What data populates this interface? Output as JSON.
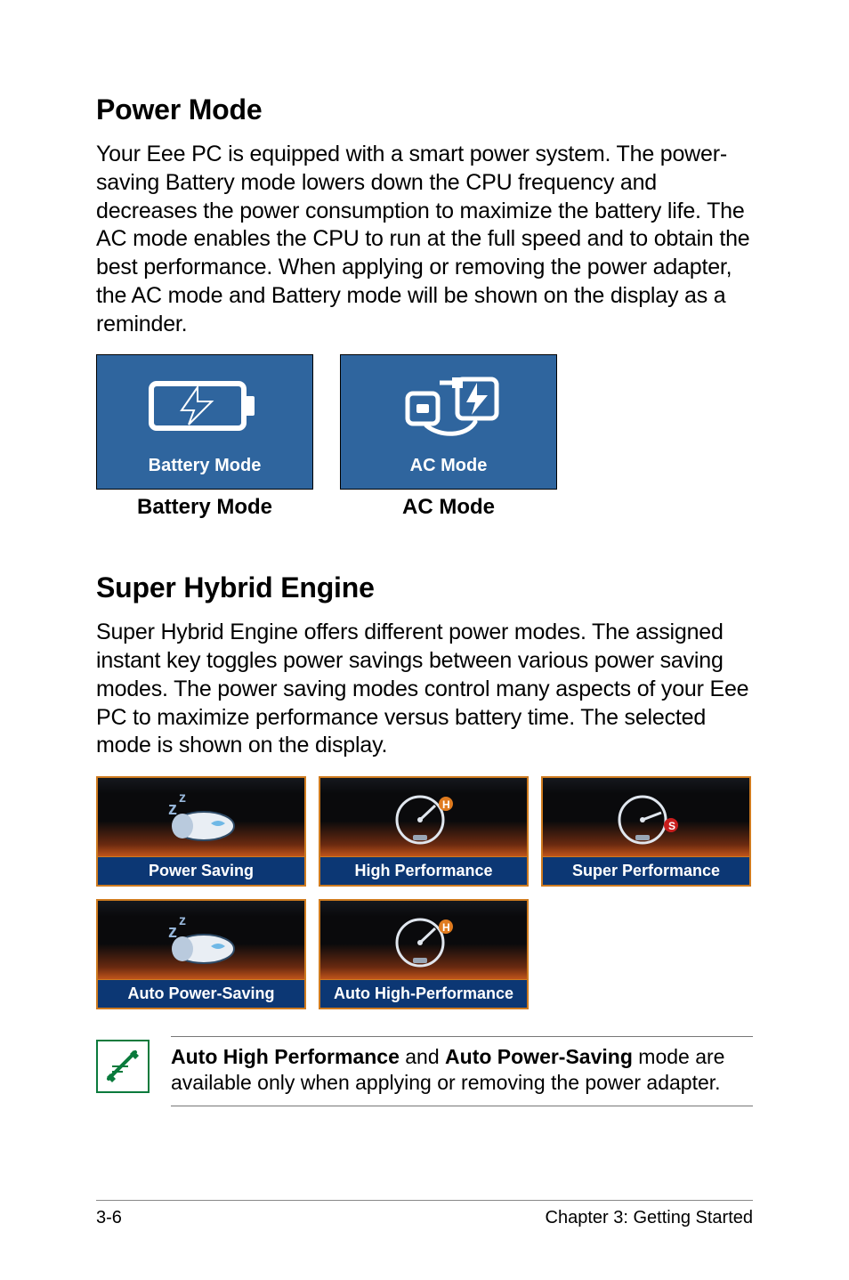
{
  "section1": {
    "heading": "Power Mode",
    "body": "Your Eee PC is equipped with a smart power system. The power-saving Battery mode lowers down the CPU frequency and decreases the power consumption to maximize the battery life. The AC mode enables the CPU to run at the full speed and to obtain the best performance. When applying or removing the power adapter, the AC mode and Battery mode will be shown on the display as a reminder.",
    "tiles": {
      "battery": {
        "tile_label": "Battery Mode",
        "caption": "Battery Mode"
      },
      "ac": {
        "tile_label": "AC Mode",
        "caption": "AC Mode"
      }
    }
  },
  "section2": {
    "heading": "Super Hybrid Engine",
    "body": "Super Hybrid Engine offers different power modes. The assigned instant key toggles power savings between various power saving modes. The power saving modes control many aspects of your Eee PC to maximize performance versus battery time. The selected mode is shown on the display.",
    "tiles": [
      {
        "label": "Power Saving"
      },
      {
        "label": "High Performance"
      },
      {
        "label": "Super Performance"
      },
      {
        "label": "Auto Power-Saving"
      },
      {
        "label": "Auto High-Performance"
      }
    ]
  },
  "note": {
    "bold1": "Auto High Performance",
    "mid1": " and ",
    "bold2": "Auto Power-Saving",
    "tail": " mode are available only when applying or removing the power adapter."
  },
  "footer": {
    "page": "3-6",
    "chapter": "Chapter 3: Getting Started"
  }
}
